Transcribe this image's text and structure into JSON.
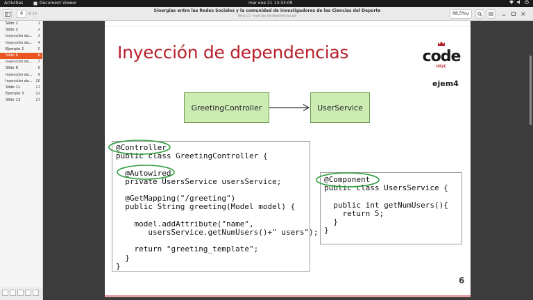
{
  "topbar": {
    "activities": "Activities",
    "app_name": "Document Viewer",
    "clock": "mar ene 21  13:33:09"
  },
  "header": {
    "page_current": "6",
    "page_total": "of 13",
    "title": "Sinergias entre las Redes Sociales y la comunidad de investigadores de las Ciencias del Deporte",
    "subtitle": "Tema 1.5 - Inyeccion de dependencias.pdf",
    "zoom": "68,5%"
  },
  "sidebar": {
    "items": [
      {
        "label": "Slide 1",
        "page": "1"
      },
      {
        "label": "Slide 2",
        "page": "2"
      },
      {
        "label": "Inyección de...",
        "page": "3"
      },
      {
        "label": "Inyección de...",
        "page": "4"
      },
      {
        "label": "Ejemplo 2",
        "page": "5"
      },
      {
        "label": "Slide 6",
        "page": "6",
        "selected": true
      },
      {
        "label": "Inyección de...",
        "page": "7"
      },
      {
        "label": "Slide 8",
        "page": "8"
      },
      {
        "label": "Inyección de...",
        "page": "9"
      },
      {
        "label": "Inyección de...",
        "page": "10"
      },
      {
        "label": "Slide 11",
        "page": "11"
      },
      {
        "label": "Ejemplo 3",
        "page": "12"
      },
      {
        "label": "Slide 13",
        "page": "13"
      }
    ]
  },
  "slide": {
    "title": "Inyección de dependencias",
    "logo_word": "code",
    "logo_sub": "URJC",
    "tag": "ejem4",
    "box_left": "GreetingController",
    "box_right": "UserService",
    "page_number": "6",
    "code_left": [
      "@Controller",
      "public class GreetingController {",
      "",
      "  @Autowired",
      "  private UsersService usersService;",
      "",
      "  @GetMapping(\"/greeting\")",
      "  public String greeting(Model model) {",
      "",
      "    model.addAttribute(\"name\",",
      "       usersService.getNumUsers()+\" users\");",
      "",
      "    return \"greeting_template\";",
      "  }",
      "}"
    ],
    "code_right": [
      "@Component",
      "public class UsersService {",
      "",
      "  public int getNumUsers(){",
      "    return 5;",
      "  }",
      "}"
    ]
  },
  "colors": {
    "accent": "#e95420",
    "title_red": "#b8202c",
    "box_fill": "#ccecb4",
    "box_border": "#6f9b52",
    "ellipse": "#2e9e3a"
  }
}
